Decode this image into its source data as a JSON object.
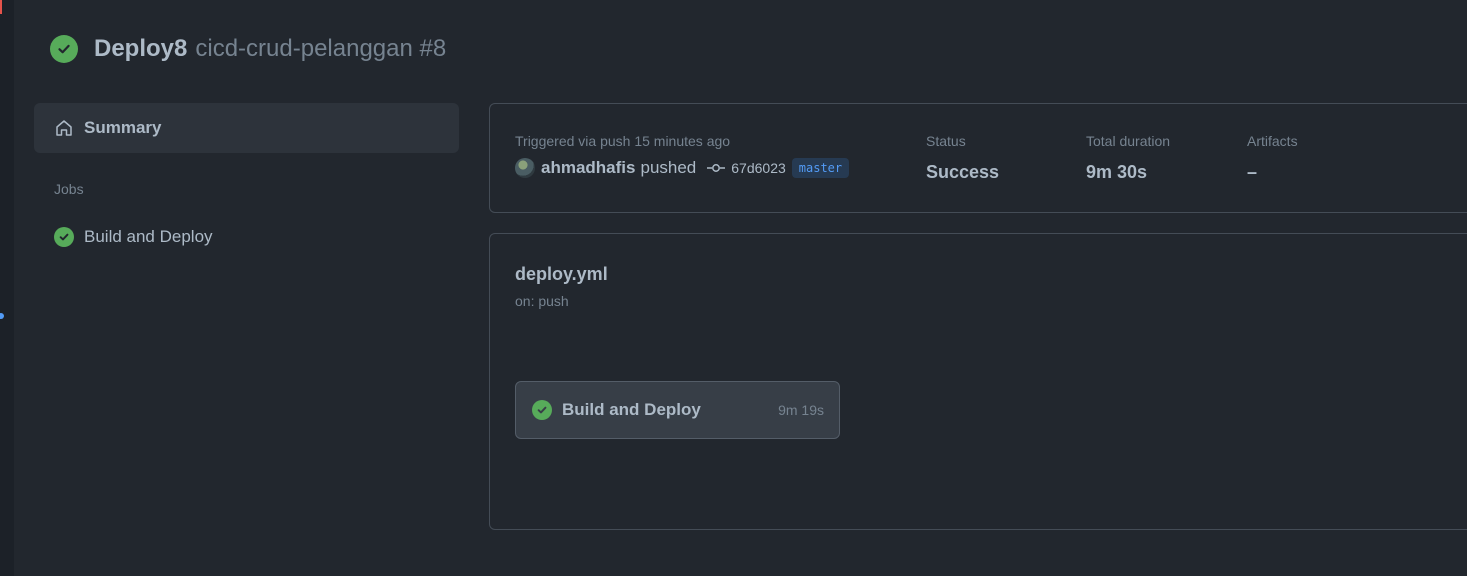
{
  "colors": {
    "background": "#22272e",
    "success": "#57ab5a",
    "branch_text": "#539bf5",
    "branch_bg": "#263a52",
    "muted": "#768390"
  },
  "header": {
    "status_icon": "check-circle-icon",
    "workflow_name": "Deploy8",
    "run_title": "cicd-crud-pelanggan #8"
  },
  "sidebar": {
    "summary_icon": "home-icon",
    "summary_label": "Summary",
    "jobs_heading": "Jobs",
    "jobs": [
      {
        "label": "Build and Deploy",
        "status_icon": "check-circle-icon"
      }
    ]
  },
  "run_info": {
    "trigger_caption": "Triggered via push 15 minutes ago",
    "user": "ahmadhafis",
    "action": "pushed",
    "commit_icon": "git-commit-icon",
    "commit_sha": "67d6023",
    "branch": "master",
    "status_caption": "Status",
    "status_value": "Success",
    "duration_caption": "Total duration",
    "duration_value": "9m 30s",
    "artifacts_caption": "Artifacts",
    "artifacts_value": "–"
  },
  "workflow_graph": {
    "file_name": "deploy.yml",
    "trigger": "on: push",
    "jobs": [
      {
        "name": "Build and Deploy",
        "duration": "9m 19s",
        "status_icon": "check-circle-icon"
      }
    ]
  }
}
